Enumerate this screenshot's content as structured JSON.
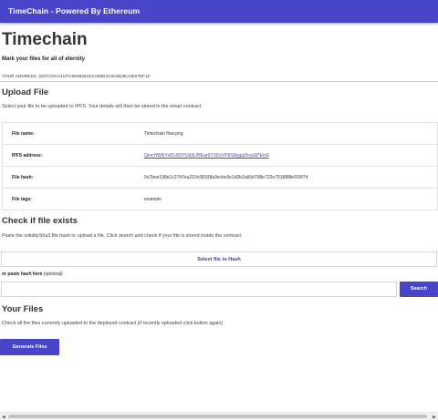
{
  "appbar": {
    "title": "TimeChain - Powered By Ethereum"
  },
  "header": {
    "title": "Timechain",
    "tagline": "Mark your files for all of eternity",
    "address": "YOUR ADDRESS: 0X07C0AC1CFC9509261DC209D4C8A9D3EA3827EF1F"
  },
  "upload": {
    "heading": "Upload File",
    "description": "Select your file to be uploaded to IPFS. Your details will then be stored in the smart contract.",
    "rows": [
      {
        "label": "File name:",
        "value": "Timechain flow.png"
      },
      {
        "label": "IPFS address:",
        "value": "QmcHWNYdGU82YUd3LBfEar6YXDzVFBS8ygq3hvaSPEm9"
      },
      {
        "label": "File hash:",
        "value": "0x7bee198e1c2747ea210c08108a3ecbc6e1d2b2a60d798e722e751888fe926f7d"
      },
      {
        "label": "File tags:",
        "value": "example"
      }
    ]
  },
  "check": {
    "heading": "Check if file exists",
    "description": "Paste the soliditySha3 file hash or upload a file. Click search and check if your file is stored inside the contract.",
    "select_button": "Select file to Hash",
    "paste_label": "or paste hash here",
    "paste_optional": "(optional)",
    "input_value": "",
    "input_placeholder": "",
    "search_button": "Search"
  },
  "files": {
    "heading": "Your Files",
    "description": "Check all the files currently uploaded to the deployed contract (if recently uploaded click button again)",
    "generate_button": "Generate Files"
  },
  "scrollbar": {
    "left_arrow": "◀",
    "right_arrow": "▶"
  },
  "colors": {
    "primary": "#4845c9",
    "link": "#5a3fb0"
  }
}
